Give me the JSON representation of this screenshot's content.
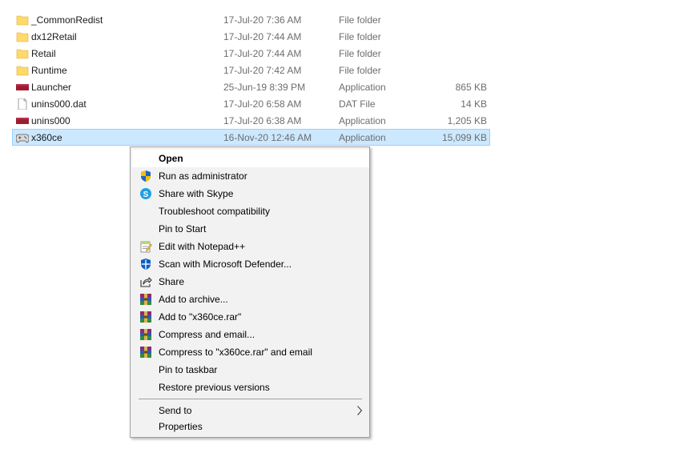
{
  "files": [
    {
      "name": "_CommonRedist",
      "date": "17-Jul-20 7:36 AM",
      "type": "File folder",
      "size": "",
      "icon": "folder-icon"
    },
    {
      "name": "dx12Retail",
      "date": "17-Jul-20 7:44 AM",
      "type": "File folder",
      "size": "",
      "icon": "folder-icon"
    },
    {
      "name": "Retail",
      "date": "17-Jul-20 7:44 AM",
      "type": "File folder",
      "size": "",
      "icon": "folder-icon"
    },
    {
      "name": "Runtime",
      "date": "17-Jul-20 7:42 AM",
      "type": "File folder",
      "size": "",
      "icon": "folder-icon"
    },
    {
      "name": "Launcher",
      "date": "25-Jun-19 8:39 PM",
      "type": "Application",
      "size": "865 KB",
      "icon": "application-icon"
    },
    {
      "name": "unins000.dat",
      "date": "17-Jul-20 6:58 AM",
      "type": "DAT File",
      "size": "14 KB",
      "icon": "document-icon"
    },
    {
      "name": "unins000",
      "date": "17-Jul-20 6:38 AM",
      "type": "Application",
      "size": "1,205 KB",
      "icon": "application-icon"
    },
    {
      "name": "x360ce",
      "date": "16-Nov-20 12:46 AM",
      "type": "Application",
      "size": "15,099 KB",
      "icon": "gamepad-icon",
      "selected": true
    }
  ],
  "context_menu": {
    "open": "Open",
    "run_as_admin": "Run as administrator",
    "share_skype": "Share with Skype",
    "troubleshoot": "Troubleshoot compatibility",
    "pin_start": "Pin to Start",
    "edit_notepad": "Edit with Notepad++",
    "scan_defender": "Scan with Microsoft Defender...",
    "share": "Share",
    "add_archive": "Add to archive...",
    "add_rar": "Add to \"x360ce.rar\"",
    "compress_email": "Compress and email...",
    "compress_rar_email": "Compress to \"x360ce.rar\" and email",
    "pin_taskbar": "Pin to taskbar",
    "restore_versions": "Restore previous versions",
    "send_to": "Send to",
    "properties": "Properties"
  },
  "colors": {
    "selection_bg": "#cce8ff",
    "selection_border": "#99d1ff",
    "folder": "#ffd96a",
    "app": "#9b1c35"
  }
}
